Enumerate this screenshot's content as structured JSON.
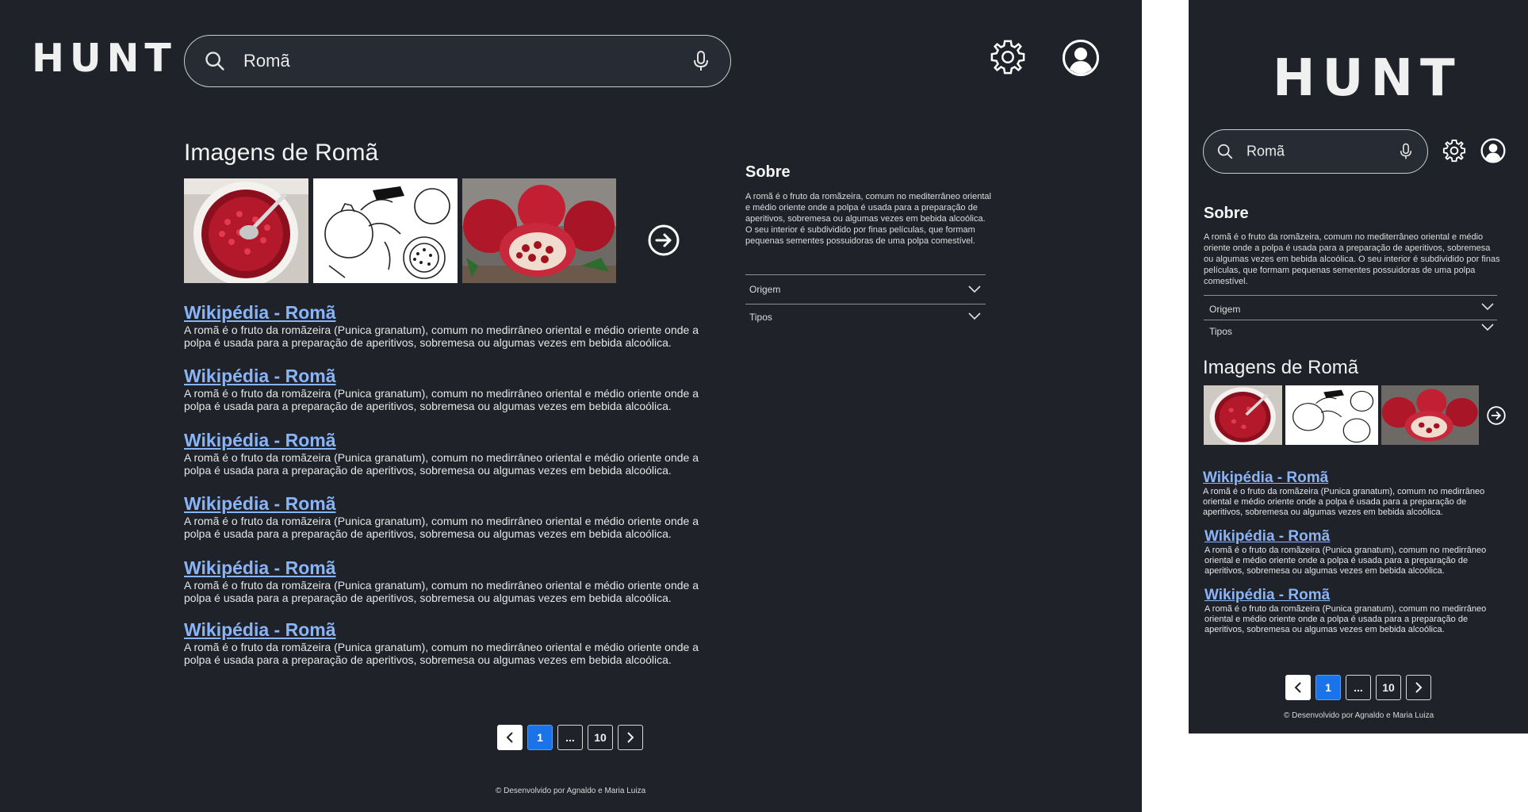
{
  "brand": {
    "logo": "HUNT"
  },
  "search": {
    "query": "Romã"
  },
  "images": {
    "heading": "Imagens de Romã",
    "thumbnails": [
      "pomegranate-seeds-bowl-photo",
      "pomegranate-sketch-illustration",
      "pomegranate-fruits-photo"
    ]
  },
  "results": [
    {
      "title": "Wikipédia - Romã",
      "snippet": "A romã é o fruto da romãzeira (Punica granatum), comum no medirrâneo oriental e  médio oriente onde a polpa é usada para a preparação de aperitivos, sobremesa ou algumas vezes em bebida alcoólica."
    },
    {
      "title": "Wikipédia - Romã",
      "snippet": "A romã é o fruto da romãzeira (Punica granatum), comum no medirrâneo oriental e  médio oriente onde a polpa é usada para a preparação de aperitivos, sobremesa ou algumas vezes em bebida alcoólica."
    },
    {
      "title": "Wikipédia - Romã",
      "snippet": "A romã é o fruto da romãzeira (Punica granatum), comum no medirrâneo oriental e  médio oriente onde a polpa é usada para a preparação de aperitivos, sobremesa ou algumas vezes em bebida alcoólica."
    },
    {
      "title": "Wikipédia - Romã",
      "snippet": "A romã é o fruto da romãzeira (Punica granatum), comum no medirrâneo oriental e  médio oriente onde a polpa é usada para a preparação de aperitivos, sobremesa ou algumas vezes em bebida alcoólica."
    },
    {
      "title": "Wikipédia - Romã",
      "snippet": "A romã é o fruto da romãzeira (Punica granatum), comum no medirrâneo oriental e  médio oriente onde a polpa é usada para a preparação de aperitivos, sobremesa ou algumas vezes em bebida alcoólica."
    },
    {
      "title": "Wikipédia - Romã",
      "snippet": "A romã é o fruto da romãzeira (Punica granatum), comum no medirrâneo oriental e  médio oriente onde a polpa é usada para a preparação de aperitivos, sobremesa ou algumas vezes em bebida alcoólica."
    }
  ],
  "about": {
    "title": "Sobre",
    "text": "A romã é o fruto da romãzeira, comum no mediterrâneo oriental e médio oriente onde a polpa é usada para a preparação de aperitivos, sobremesa ou algumas vezes em bebida alcoólica. O seu interior é subdividido por finas películas, que formam pequenas sementes possuidoras de uma polpa comestível.",
    "sections": [
      "Origem",
      "Tipos"
    ]
  },
  "pagination": {
    "current": "1",
    "ellipsis": "...",
    "last": "10"
  },
  "footer": {
    "text": "© Desenvolvido por Agnaldo e Maria Luiza"
  },
  "colors": {
    "background": "#1f2229",
    "link": "#8ab4f8",
    "accent": "#1a73e8"
  }
}
